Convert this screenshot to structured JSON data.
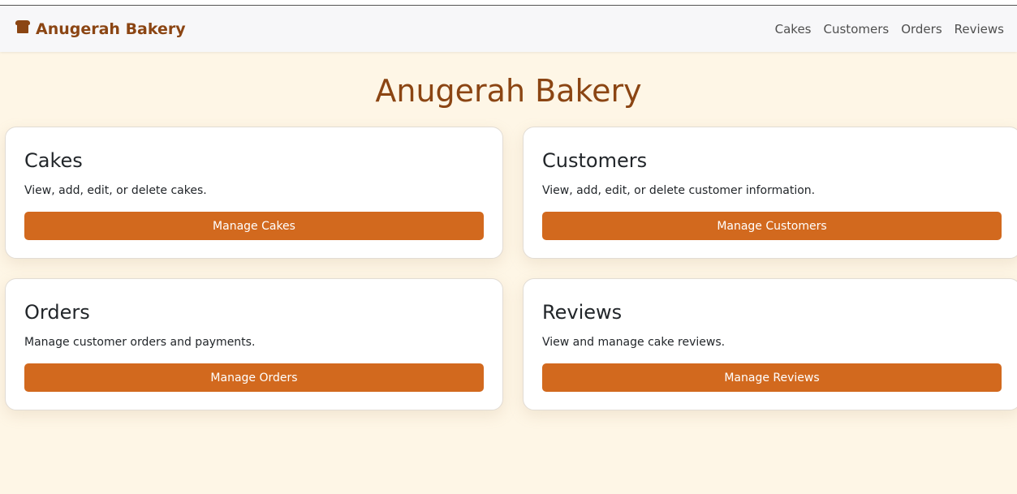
{
  "navbar": {
    "brand": "Anugerah Bakery",
    "brand_icon": "bread-icon",
    "links": [
      "Cakes",
      "Customers",
      "Orders",
      "Reviews"
    ]
  },
  "page_title": "Anugerah Bakery",
  "cards": [
    {
      "title": "Cakes",
      "text": "View, add, edit, or delete cakes.",
      "button": "Manage Cakes"
    },
    {
      "title": "Customers",
      "text": "View, add, edit, or delete customer information.",
      "button": "Manage Customers"
    },
    {
      "title": "Orders",
      "text": "Manage customer orders and payments.",
      "button": "Manage Orders"
    },
    {
      "title": "Reviews",
      "text": "View and manage cake reviews.",
      "button": "Manage Reviews"
    }
  ],
  "colors": {
    "brand": "#8b4513",
    "button": "#d2691e",
    "background": "#fef6e6"
  }
}
